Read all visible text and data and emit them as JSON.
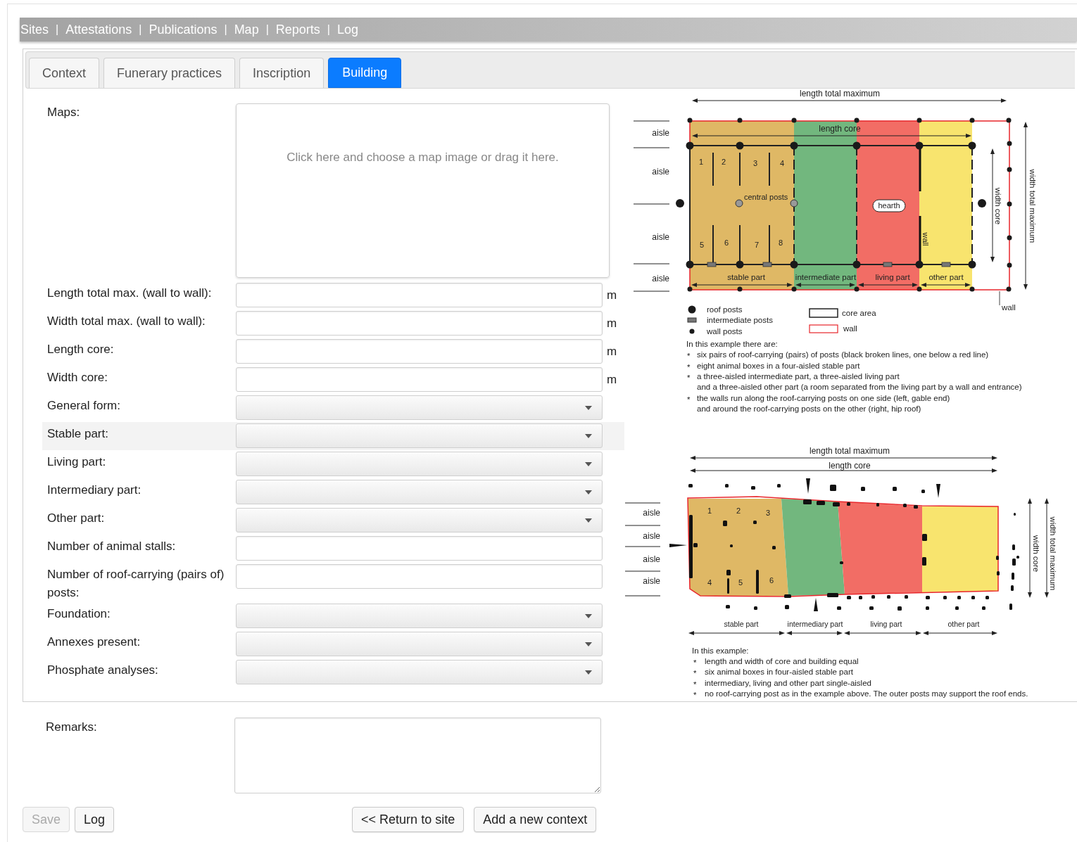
{
  "nav": [
    {
      "kind": "link",
      "label": "Sites"
    },
    {
      "kind": "separator",
      "label": "|"
    },
    {
      "kind": "link",
      "label": "Attestations"
    },
    {
      "kind": "separator",
      "label": "|"
    },
    {
      "kind": "link",
      "label": "Publications"
    },
    {
      "kind": "separator",
      "label": "|"
    },
    {
      "kind": "link",
      "label": "Map"
    },
    {
      "kind": "separator",
      "label": "|"
    },
    {
      "kind": "link",
      "label": "Reports"
    },
    {
      "kind": "separator",
      "label": "|"
    },
    {
      "kind": "link",
      "label": "Log"
    }
  ],
  "tabs": [
    {
      "label": "Context",
      "selected": false
    },
    {
      "label": "Funerary practices",
      "selected": false
    },
    {
      "label": "Inscription",
      "selected": false
    },
    {
      "label": "Building",
      "selected": true
    }
  ],
  "form": {
    "fields": [
      {
        "kind": "map_drop",
        "label": "Maps:",
        "prompt": "Click here and choose a map image or drag it here.",
        "hovered": false
      },
      {
        "kind": "text",
        "label": "Length total max. (wall to wall):",
        "unit": "m",
        "hovered": false
      },
      {
        "kind": "text",
        "label": "Width total max. (wall to wall):",
        "unit": "m",
        "hovered": false
      },
      {
        "kind": "text",
        "label": "Length core:",
        "unit": "m",
        "hovered": false
      },
      {
        "kind": "text",
        "label": "Width core:",
        "unit": "m",
        "hovered": false
      },
      {
        "kind": "select",
        "label": "General form:",
        "hovered": false
      },
      {
        "kind": "select",
        "label": "Stable part:",
        "hovered": true
      },
      {
        "kind": "select",
        "label": "Living part:",
        "hovered": false
      },
      {
        "kind": "select",
        "label": "Intermediary part:",
        "hovered": false
      },
      {
        "kind": "select",
        "label": "Other part:",
        "hovered": false
      },
      {
        "kind": "text",
        "label": "Number of animal stalls:",
        "hovered": false
      },
      {
        "kind": "text",
        "label": "Number of roof-carrying (pairs of) posts:",
        "hovered": false
      },
      {
        "kind": "select",
        "label": "Foundation:",
        "hovered": false
      },
      {
        "kind": "select",
        "label": "Annexes present:",
        "hovered": false
      },
      {
        "kind": "select",
        "label": "Phosphate analyses:",
        "hovered": false
      }
    ]
  },
  "top_diagram": {
    "length_total": "length total maximum",
    "length_core": "length core",
    "aisles": [
      "aisle",
      "aisle",
      "aisle",
      "aisle"
    ],
    "stalls": [
      "1",
      "2",
      "3",
      "4",
      "5",
      "6",
      "7",
      "8"
    ],
    "central_posts": "central posts",
    "hearth": "hearth",
    "inner_wall": "wall",
    "parts": [
      {
        "label": "stable part",
        "color": "#dfb865"
      },
      {
        "label": "intermediate part",
        "color": "#72b77e"
      },
      {
        "label": "living part",
        "color": "#f26d65"
      },
      {
        "label": "other part",
        "color": "#f8e46e"
      }
    ],
    "width_core": "width core",
    "width_total": "width total maximum",
    "outer_wall": "wall",
    "legend": [
      {
        "kind": "roof_post",
        "label": "roof posts"
      },
      {
        "kind": "intermediate_post",
        "label": "intermediate posts"
      },
      {
        "kind": "wall_post",
        "label": "wall posts"
      },
      {
        "kind": "core_area",
        "label": "core area"
      },
      {
        "kind": "wall",
        "label": "wall"
      }
    ],
    "notes_intro": "In this example there are:",
    "notes": [
      {
        "marker": "*",
        "lines": [
          "six pairs of roof-carrying (pairs) of posts (black broken lines, one below a red line)"
        ]
      },
      {
        "marker": "*",
        "lines": [
          "eight animal boxes in a four-aisled stable part"
        ]
      },
      {
        "marker": "*",
        "lines": [
          "a three-aisled intermediate part, a three-aisled living part",
          "and a three-aisled other part (a room separated from the living part by a wall and entrance)"
        ]
      },
      {
        "marker": "*",
        "lines": [
          "the walls run along the roof-carrying posts on one side (left, gable end)",
          "and around the roof-carrying posts on the other (right, hip roof)"
        ]
      }
    ]
  },
  "bottom_diagram": {
    "length_total": "length total maximum",
    "length_core": "length core",
    "aisles": [
      "aisle",
      "aisle",
      "aisle",
      "aisle"
    ],
    "stalls": [
      "1",
      "2",
      "3",
      "4",
      "5",
      "6"
    ],
    "parts": [
      {
        "label": "stable part",
        "color": "#dfb865"
      },
      {
        "label": "intermediary part",
        "color": "#72b77e"
      },
      {
        "label": "living part",
        "color": "#f26d65"
      },
      {
        "label": "other part",
        "color": "#f8e46e"
      }
    ],
    "width_core": "width core",
    "width_total": "width total maximum",
    "notes_intro": "In this example:",
    "notes": [
      {
        "marker": "*",
        "lines": [
          "length and width of core and building equal"
        ]
      },
      {
        "marker": "*",
        "lines": [
          "six animal boxes in four-aisled stable part"
        ]
      },
      {
        "marker": "*",
        "lines": [
          "intermediary, living and other part single-aisled"
        ]
      },
      {
        "marker": "*",
        "lines": [
          "no roof-carrying post as in the example above. The outer posts may support the roof ends."
        ]
      }
    ]
  },
  "remarks": {
    "label": "Remarks:"
  },
  "actions_left": [
    {
      "label": "Save",
      "disabled": true
    },
    {
      "label": "Log",
      "disabled": false
    }
  ],
  "actions_right": [
    {
      "label": "<< Return to site",
      "disabled": false
    },
    {
      "label": "Add a new context",
      "disabled": false
    }
  ]
}
